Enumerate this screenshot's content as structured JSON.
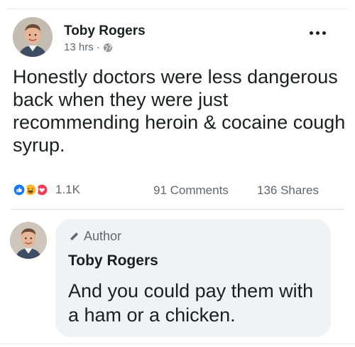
{
  "post": {
    "author": "Toby Rogers",
    "time": "13 hrs",
    "separator": "·",
    "privacy_icon": "globe-icon",
    "more_icon": "more-options-icon",
    "text": "Honestly doctors were less dangerous back when they were just recommending heroin & cocaine cough syrup.",
    "reactions": {
      "icons": [
        "like-icon",
        "haha-icon",
        "love-icon"
      ],
      "count": "1.1K"
    },
    "comments": "91 Comments",
    "shares": "136 Shares"
  },
  "comment": {
    "badge_icon": "pencil-icon",
    "badge_label": "Author",
    "author": "Toby Rogers",
    "text": "And you could pay them with a ham or a chicken."
  },
  "colors": {
    "like": "#1877f2",
    "haha": "#f7b928",
    "love": "#f33e58",
    "secondary_text": "#606770",
    "bubble": "#f0f2f5"
  }
}
